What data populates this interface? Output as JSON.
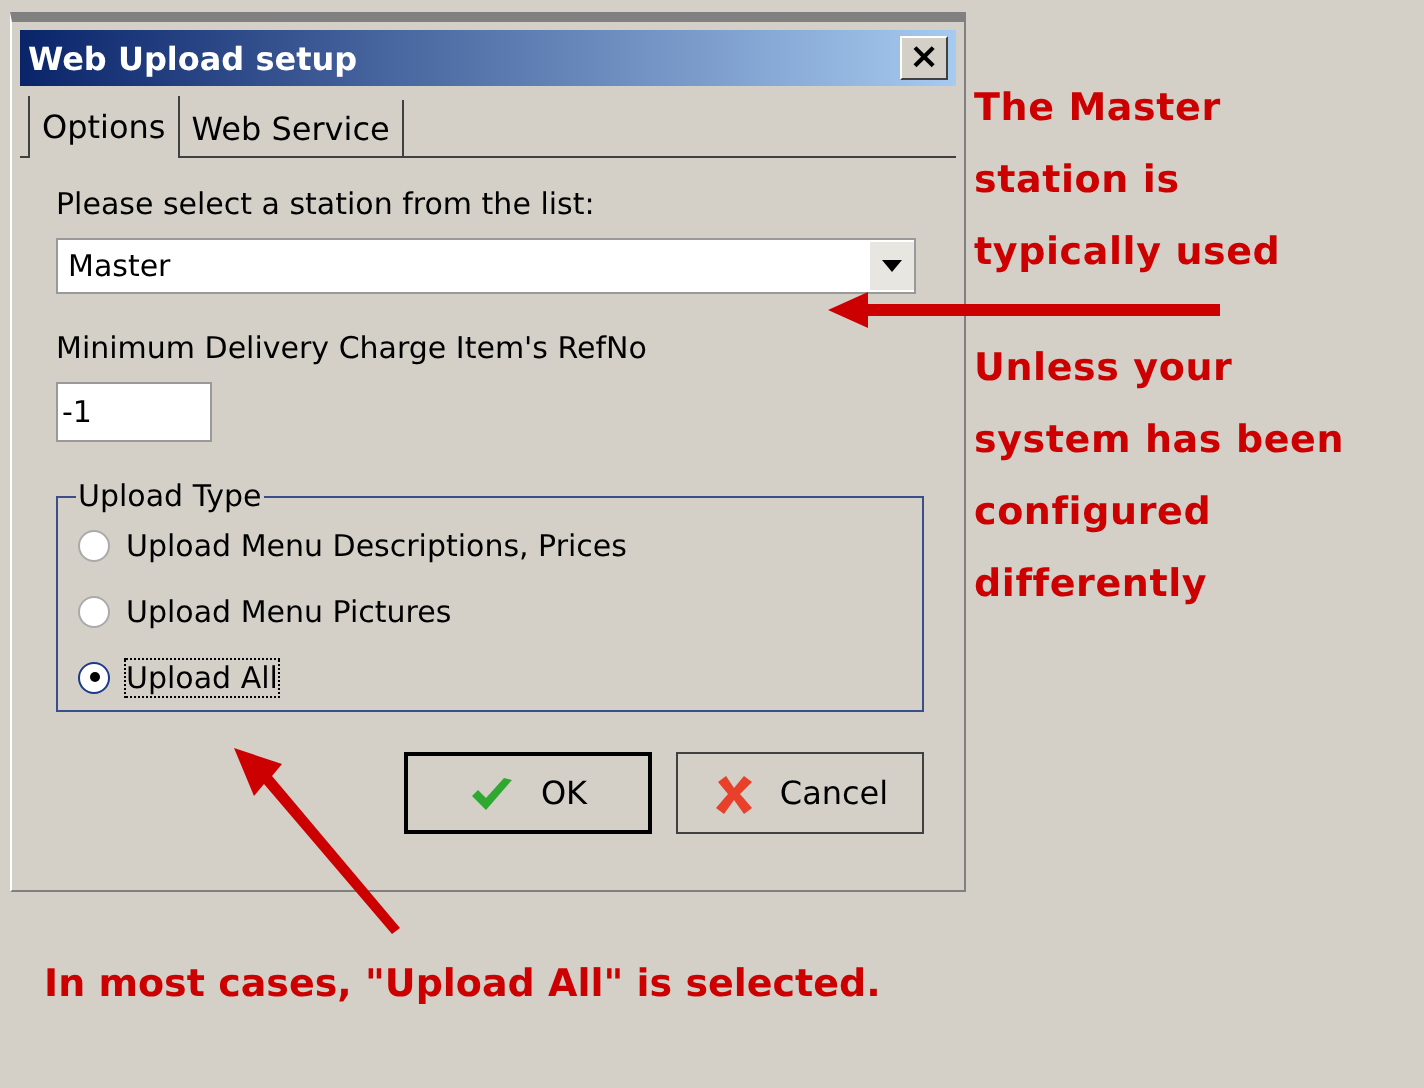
{
  "window": {
    "title": "Web Upload setup",
    "close": "×"
  },
  "tabs": [
    {
      "label": "Options",
      "selected": true
    },
    {
      "label": "Web Service",
      "selected": false
    }
  ],
  "station": {
    "label": "Please select a station from the list:",
    "value": "Master"
  },
  "refno": {
    "label": "Minimum Delivery Charge Item's RefNo",
    "value": "-1"
  },
  "upload_type": {
    "title": "Upload Type",
    "options": [
      {
        "label": "Upload Menu Descriptions, Prices",
        "selected": false
      },
      {
        "label": "Upload Menu Pictures",
        "selected": false
      },
      {
        "label": "Upload All",
        "selected": true
      }
    ]
  },
  "buttons": [
    {
      "kind": "ok",
      "label": "OK"
    },
    {
      "kind": "cancel",
      "label": "Cancel"
    }
  ],
  "annotations": {
    "top": "The Master station is typically used",
    "middle": "Unless your system has been configured differently",
    "bottom": "In most cases, \"Upload All\" is selected."
  }
}
